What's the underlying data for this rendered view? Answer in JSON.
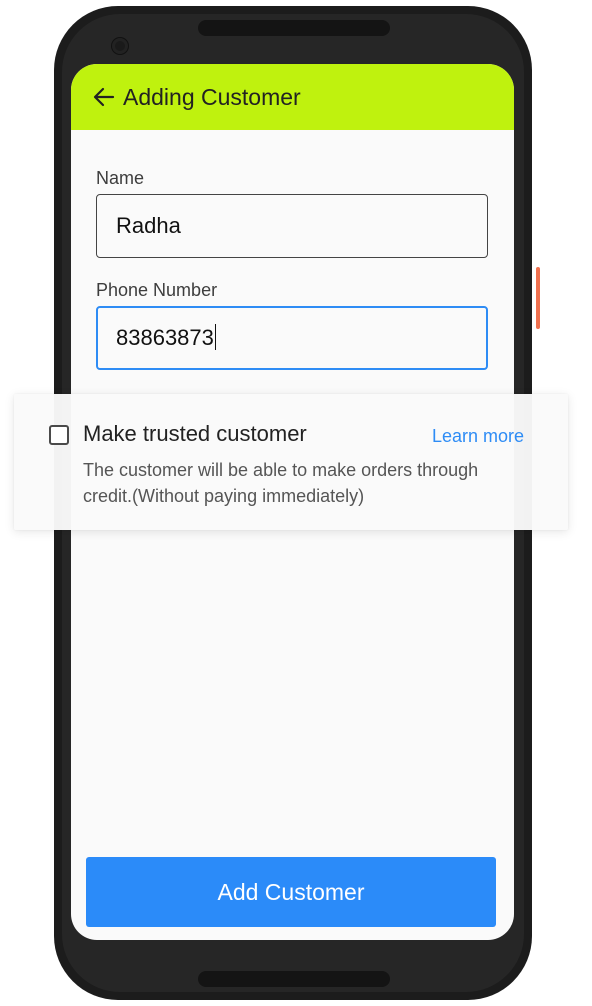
{
  "app_bar": {
    "title": "Adding Customer",
    "back_icon": "arrow-left-icon",
    "color": "#bff20e"
  },
  "form": {
    "name_label": "Name",
    "name_value": "Radha",
    "phone_label": "Phone Number",
    "phone_value": "83863873"
  },
  "trusted": {
    "checked": false,
    "title": "Make trusted customer",
    "learn_more": "Learn more",
    "description": "The customer will be able to make orders through credit.(Without paying immediately)"
  },
  "submit": {
    "label": "Add Customer",
    "color": "#2b8bf9"
  },
  "colors": {
    "accent": "#2e8cf5",
    "device_side_button": "#f0714f"
  }
}
